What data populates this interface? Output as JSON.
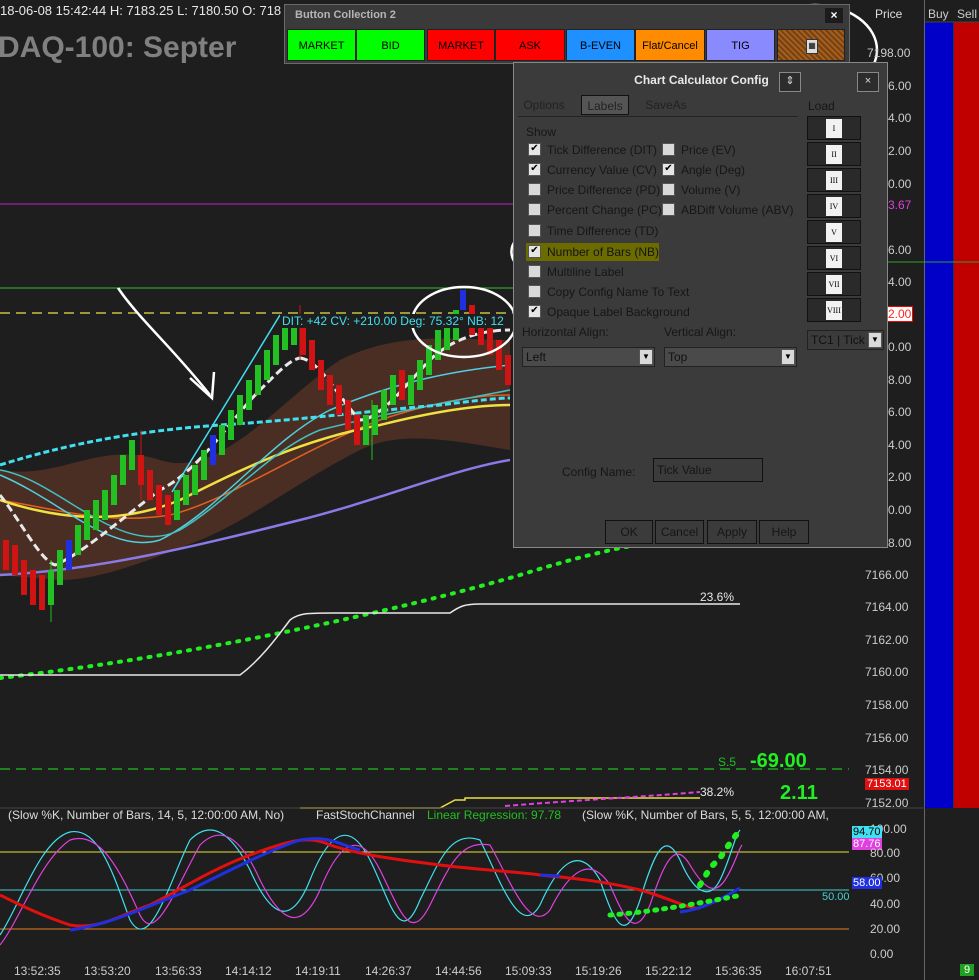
{
  "header": {
    "info_line": "18-06-08 15:42:44 H: 7183.25 L: 7180.50 O: 718",
    "title": "DAQ-100: Septer"
  },
  "price_axis": {
    "header": "Price",
    "labels": [
      "7198.00",
      "7196.00",
      "7194.00",
      "7192.00",
      "7190.00",
      "7188.00",
      "7186.00",
      "7184.00",
      "7182.00",
      "7180.00",
      "7178.00",
      "7176.00",
      "7174.00",
      "7172.00",
      "7170.00",
      "7168.00",
      "7166.00",
      "7164.00",
      "7162.00",
      "7160.00",
      "7158.00",
      "7156.00",
      "7154.00",
      "7152.00"
    ],
    "visible_partial": {
      "p86": "6.00",
      "p84": "4.00",
      "p82": "2.00",
      "p80": "0.00",
      "p78": "8.00",
      "p76": "6.00",
      "p74": "4.00",
      "p72": "2.00",
      "p70": "0.00",
      "p68": "8.00",
      "p66": "6.00",
      "p64": "4.00",
      "p62": "2.00",
      "p60": "0.00"
    },
    "labels_shown": [
      "7198.00",
      "7166.00",
      "7164.00",
      "7162.00",
      "7160.00",
      "7158.00",
      "7156.00",
      "7154.00",
      "7152.00"
    ],
    "tag_magenta": "3.67",
    "tag_red": "2.00",
    "tag_price_red": "7153.01"
  },
  "side_columns": {
    "buy": "Buy",
    "sell": "Sell",
    "counter": "9"
  },
  "fib": {
    "level_1": "23.6%",
    "level_2": "38.2%",
    "s5": "S.5",
    "value_a": "-69.00",
    "value_b": "2.11"
  },
  "annotation": "DIT: +42  CV: +210.00  Deg: 75.32°  NB: 12",
  "indicator_panel": {
    "label_1": "(Slow %K, Number of Bars, 14, 5, 12:00:00 AM, No)",
    "label_2": "FastStochChannel",
    "label_3": "Linear Regression: 97.78",
    "label_4": "(Slow %K, Number of Bars, 5, 5, 12:00:00 AM,",
    "axis": [
      "80.00",
      "60.00",
      "40.00",
      "20.00",
      "0.00"
    ],
    "axis_top": "100.00",
    "tag_cyan": "94.70",
    "tag_magenta": "87.76",
    "tag_blue": "58.00",
    "line_50": "50.00"
  },
  "time_axis": [
    "13:52:35",
    "13:53:20",
    "13:56:33",
    "14:14:12",
    "14:19:11",
    "14:26:37",
    "14:44:56",
    "15:09:33",
    "15:19:26",
    "15:22:12",
    "15:36:35",
    "16:07:51"
  ],
  "button_collection": {
    "title": "Button Collection 2",
    "close": "×",
    "buttons": [
      {
        "label": "MARKET",
        "bg": "#00ff00",
        "fg": "#000000"
      },
      {
        "label": "BID",
        "bg": "#00ff00",
        "fg": "#000000"
      },
      {
        "label": "MARKET",
        "bg": "#ff0000",
        "fg": "#000000"
      },
      {
        "label": "ASK",
        "bg": "#ff0000",
        "fg": "#000000"
      },
      {
        "label": "B-EVEN",
        "bg": "#1e90ff",
        "fg": "#000000"
      },
      {
        "label": "Flat/Cancel",
        "bg": "#ff8c00",
        "fg": "#000000"
      },
      {
        "label": "TIG",
        "bg": "#8080ff",
        "fg": "#000000"
      }
    ],
    "calculator_icon": "calculator-icon"
  },
  "dialog": {
    "title": "Chart Calculator Config",
    "close": "×",
    "tabs": [
      "Options",
      "Labels",
      "SaveAs"
    ],
    "active_tab": "Labels",
    "show_label": "Show",
    "left_checks": [
      {
        "label": "Tick Difference (DIT)",
        "checked": true
      },
      {
        "label": "Currency Value (CV)",
        "checked": true
      },
      {
        "label": "Price Difference (PD)",
        "checked": false
      },
      {
        "label": "Percent Change (PC)",
        "checked": false
      },
      {
        "label": "Time Difference (TD)",
        "checked": false
      },
      {
        "label": "Number of Bars (NB)",
        "checked": true
      },
      {
        "label": "Multiline Label",
        "checked": false
      },
      {
        "label": "Copy Config Name To Text",
        "checked": false
      },
      {
        "label": "Opaque Label Background",
        "checked": true
      }
    ],
    "right_checks": [
      {
        "label": "Price (EV)",
        "checked": false
      },
      {
        "label": "Angle (Deg)",
        "checked": true
      },
      {
        "label": "Volume (V)",
        "checked": false
      },
      {
        "label": "ABDiff Volume (ABV)",
        "checked": false
      }
    ],
    "h_align_label": "Horizontal Align:",
    "h_align_value": "Left",
    "v_align_label": "Vertical Align:",
    "v_align_value": "Top",
    "config_name_label": "Config Name:",
    "config_name_value": "Tick Value",
    "load_label": "Load",
    "load_items": [
      "I",
      "II",
      "III",
      "IV",
      "V",
      "VI",
      "VII",
      "VIII"
    ],
    "tc_select": "TC1 | Tick",
    "buttons": {
      "ok": "OK",
      "cancel": "Cancel",
      "apply": "Apply",
      "help": "Help"
    },
    "up_icon": "⇕"
  },
  "colors": {
    "background": "#1e1e1e",
    "buy_column": "#0000cc",
    "sell_column": "#cc0000",
    "highlight": "#6b6b00",
    "up_candle": "#22c022",
    "down_candle": "#d01414"
  }
}
